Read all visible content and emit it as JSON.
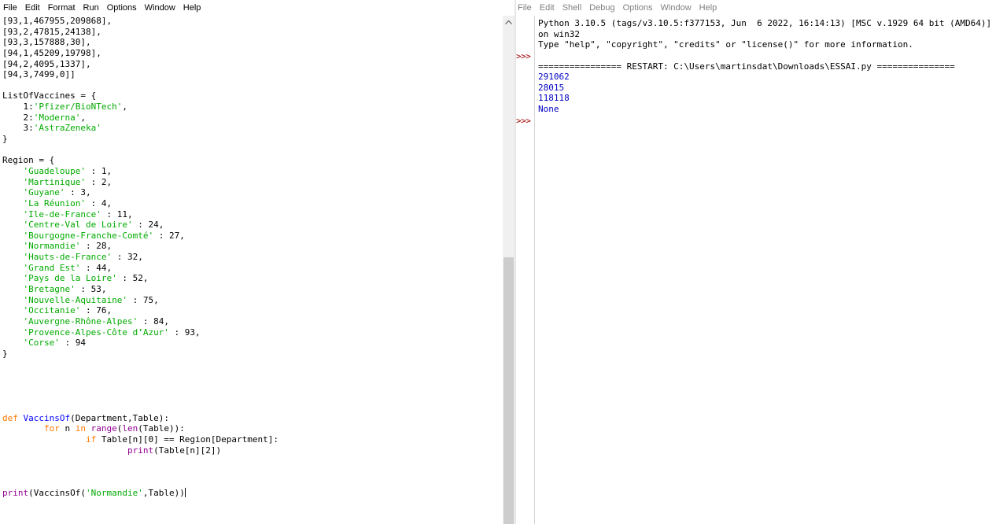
{
  "editor": {
    "menu": [
      "File",
      "Edit",
      "Format",
      "Run",
      "Options",
      "Window",
      "Help"
    ],
    "lines": [
      [
        {
          "t": "[93,1,467955,209868],"
        }
      ],
      [
        {
          "t": "[93,2,47815,24138],"
        }
      ],
      [
        {
          "t": "[93,3,157888,30],"
        }
      ],
      [
        {
          "t": "[94,1,45209,19798],"
        }
      ],
      [
        {
          "t": "[94,2,4095,1337],"
        }
      ],
      [
        {
          "t": "[94,3,7499,0]]"
        }
      ],
      [],
      [
        {
          "t": "ListOfVaccines = {"
        }
      ],
      [
        {
          "t": "    1:"
        },
        {
          "t": "'Pfizer/BioNTech'",
          "c": "str"
        },
        {
          "t": ","
        }
      ],
      [
        {
          "t": "    2:"
        },
        {
          "t": "'Moderna'",
          "c": "str"
        },
        {
          "t": ","
        }
      ],
      [
        {
          "t": "    3:"
        },
        {
          "t": "'AstraZeneka'",
          "c": "str"
        }
      ],
      [
        {
          "t": "}"
        }
      ],
      [],
      [
        {
          "t": "Region = {"
        }
      ],
      [
        {
          "t": "    "
        },
        {
          "t": "'Guadeloupe'",
          "c": "str"
        },
        {
          "t": " : 1,"
        }
      ],
      [
        {
          "t": "    "
        },
        {
          "t": "'Martinique'",
          "c": "str"
        },
        {
          "t": " : 2,"
        }
      ],
      [
        {
          "t": "    "
        },
        {
          "t": "'Guyane'",
          "c": "str"
        },
        {
          "t": " : 3,"
        }
      ],
      [
        {
          "t": "    "
        },
        {
          "t": "'La Réunion'",
          "c": "str"
        },
        {
          "t": " : 4,"
        }
      ],
      [
        {
          "t": "    "
        },
        {
          "t": "'Ile-de-France'",
          "c": "str"
        },
        {
          "t": " : 11,"
        }
      ],
      [
        {
          "t": "    "
        },
        {
          "t": "'Centre-Val de Loire'",
          "c": "str"
        },
        {
          "t": " : 24,"
        }
      ],
      [
        {
          "t": "    "
        },
        {
          "t": "'Bourgogne-Franche-Comté'",
          "c": "str"
        },
        {
          "t": " : 27,"
        }
      ],
      [
        {
          "t": "    "
        },
        {
          "t": "'Normandie'",
          "c": "str"
        },
        {
          "t": " : 28,"
        }
      ],
      [
        {
          "t": "    "
        },
        {
          "t": "'Hauts-de-France'",
          "c": "str"
        },
        {
          "t": " : 32,"
        }
      ],
      [
        {
          "t": "    "
        },
        {
          "t": "'Grand Est'",
          "c": "str"
        },
        {
          "t": " : 44,"
        }
      ],
      [
        {
          "t": "    "
        },
        {
          "t": "'Pays de la Loire'",
          "c": "str"
        },
        {
          "t": " : 52,"
        }
      ],
      [
        {
          "t": "    "
        },
        {
          "t": "'Bretagne'",
          "c": "str"
        },
        {
          "t": " : 53,"
        }
      ],
      [
        {
          "t": "    "
        },
        {
          "t": "'Nouvelle-Aquitaine'",
          "c": "str"
        },
        {
          "t": " : 75,"
        }
      ],
      [
        {
          "t": "    "
        },
        {
          "t": "'Occitanie'",
          "c": "str"
        },
        {
          "t": " : 76,"
        }
      ],
      [
        {
          "t": "    "
        },
        {
          "t": "'Auvergne-Rhône-Alpes'",
          "c": "str"
        },
        {
          "t": " : 84,"
        }
      ],
      [
        {
          "t": "    "
        },
        {
          "t": "'Provence-Alpes-Côte d’Azur'",
          "c": "str"
        },
        {
          "t": " : 93,"
        }
      ],
      [
        {
          "t": "    "
        },
        {
          "t": "'Corse'",
          "c": "str"
        },
        {
          "t": " : 94"
        }
      ],
      [
        {
          "t": "}"
        }
      ],
      [],
      [],
      [],
      [],
      [],
      [
        {
          "t": "def",
          "c": "kw"
        },
        {
          "t": " "
        },
        {
          "t": "VaccinsOf",
          "c": "def"
        },
        {
          "t": "(Department,Table):"
        }
      ],
      [
        {
          "t": "        "
        },
        {
          "t": "for",
          "c": "kw"
        },
        {
          "t": " n "
        },
        {
          "t": "in",
          "c": "kw"
        },
        {
          "t": " "
        },
        {
          "t": "range",
          "c": "bi"
        },
        {
          "t": "("
        },
        {
          "t": "len",
          "c": "bi"
        },
        {
          "t": "(Table)):"
        }
      ],
      [
        {
          "t": "                "
        },
        {
          "t": "if",
          "c": "kw"
        },
        {
          "t": " Table[n][0] == Region[Department]:"
        }
      ],
      [
        {
          "t": "                        "
        },
        {
          "t": "print",
          "c": "bi"
        },
        {
          "t": "(Table[n][2])"
        }
      ],
      [],
      [],
      [],
      [
        {
          "t": "print",
          "c": "bi"
        },
        {
          "t": "(VaccinsOf("
        },
        {
          "t": "'Normandie'",
          "c": "str"
        },
        {
          "t": ",Table))"
        }
      ]
    ]
  },
  "shell": {
    "menu": [
      "File",
      "Edit",
      "Shell",
      "Debug",
      "Options",
      "Window",
      "Help"
    ],
    "prompt": ">>>",
    "lines": [
      {
        "t": "Python 3.10.5 (tags/v3.10.5:f377153, Jun  6 2022, 16:14:13) [MSC v.1929 64 bit (AMD64)]"
      },
      {
        "t": "on win32"
      },
      {
        "t": "Type \"help\", \"copyright\", \"credits\" or \"license()\" for more information."
      },
      {
        "t": ""
      },
      {
        "t": "================ RESTART: C:\\Users\\martinsdat\\Downloads\\ESSAI.py ==============="
      },
      {
        "t": "291062",
        "c": "out"
      },
      {
        "t": "28015",
        "c": "out"
      },
      {
        "t": "118118",
        "c": "out"
      },
      {
        "t": "None",
        "c": "out"
      }
    ]
  },
  "colors": {
    "keyword": "#ff7700",
    "string": "#00aa00",
    "builtin": "#900090",
    "definition": "#0000ff",
    "output": "#0000c0",
    "prompt": "#a00000"
  },
  "icons": {
    "scroll_up": "chevron-up-icon"
  }
}
